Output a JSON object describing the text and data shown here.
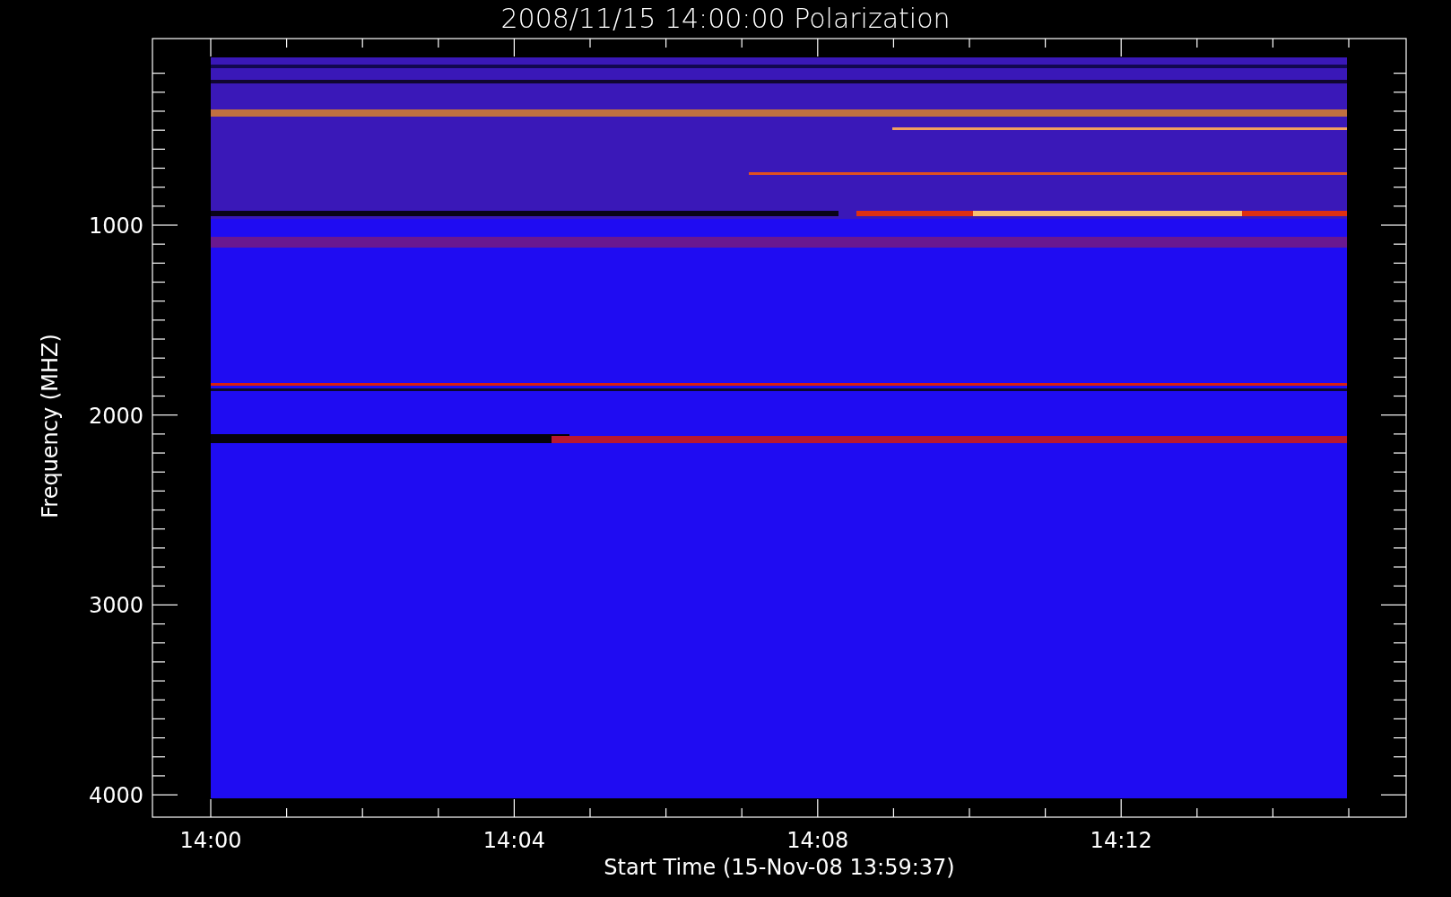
{
  "title": "2008/11/15 14:00:00 Polarization",
  "y_axis": {
    "label": "Frequency (MHZ)",
    "ticks": [
      "1000",
      "2000",
      "3000",
      "4000"
    ]
  },
  "x_axis": {
    "label": "Start Time (15-Nov-08 13:59:37)",
    "ticks": [
      "14:00",
      "14:04",
      "14:08",
      "14:12"
    ]
  }
}
